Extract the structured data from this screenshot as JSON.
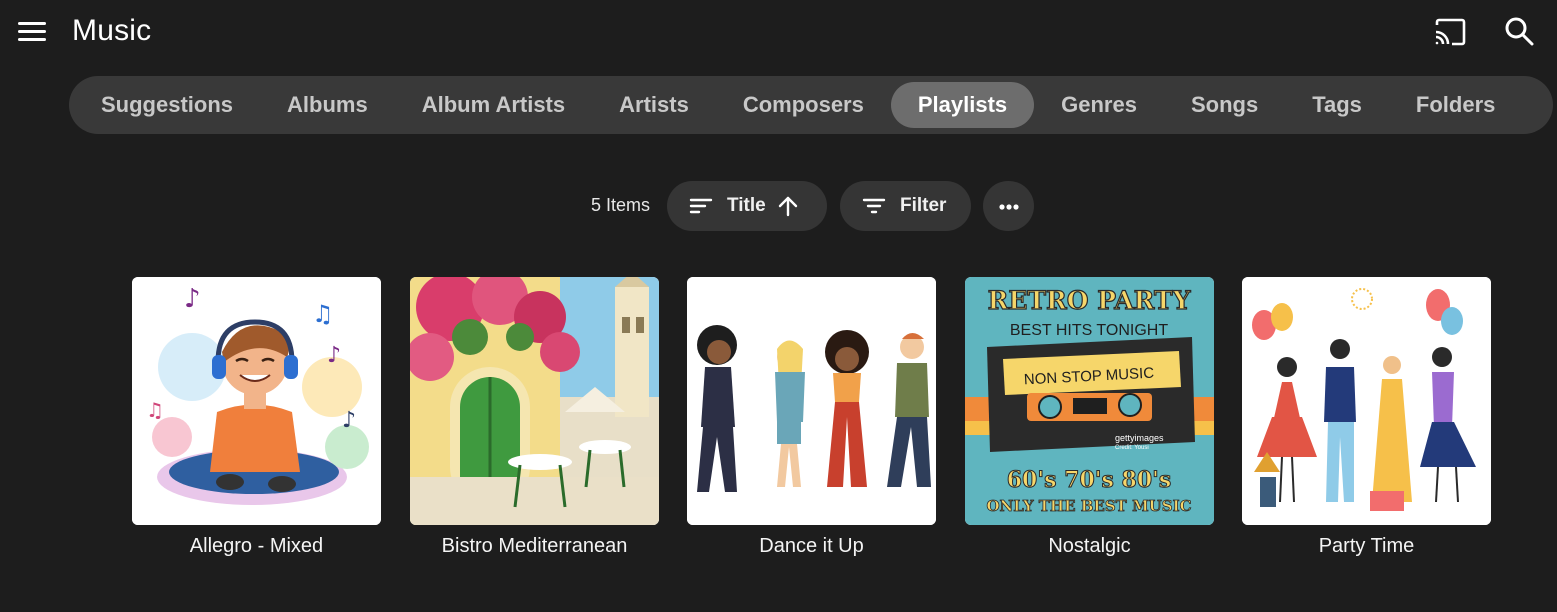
{
  "header": {
    "title": "Music"
  },
  "tabs": [
    {
      "label": "Suggestions",
      "active": false
    },
    {
      "label": "Albums",
      "active": false
    },
    {
      "label": "Album Artists",
      "active": false
    },
    {
      "label": "Artists",
      "active": false
    },
    {
      "label": "Composers",
      "active": false
    },
    {
      "label": "Playlists",
      "active": true
    },
    {
      "label": "Genres",
      "active": false
    },
    {
      "label": "Songs",
      "active": false
    },
    {
      "label": "Tags",
      "active": false
    },
    {
      "label": "Folders",
      "active": false
    }
  ],
  "toolbar": {
    "item_count": "5 Items",
    "sort_label": "Title",
    "sort_direction": "ascending",
    "filter_label": "Filter"
  },
  "icons": {
    "menu": "menu-icon",
    "cast": "cast-icon",
    "search": "search-icon",
    "sort": "sort-lines-icon",
    "sort_direction": "arrow-up-icon",
    "filter": "filter-icon",
    "more": "more-horizontal-icon"
  },
  "playlists": [
    {
      "title": "Allegro - Mixed"
    },
    {
      "title": "Bistro Mediterranean"
    },
    {
      "title": "Dance it Up"
    },
    {
      "title": "Nostalgic",
      "art_text": [
        "RETRO PARTY",
        "BEST HITS TONIGHT",
        "NON STOP MUSIC",
        "60's 70's 80's",
        "ONLY THE BEST MUSIC"
      ],
      "watermark": "gettyimages",
      "watermark_credit": "Credit: Yousi"
    },
    {
      "title": "Party Time"
    }
  ],
  "colors": {
    "background": "#1d1d1d",
    "tabbar": "#393939",
    "active_tab": "#6d6d6d",
    "pill": "#353535"
  }
}
